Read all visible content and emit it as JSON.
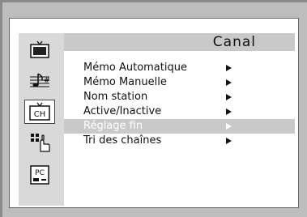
{
  "header": {
    "title": "Canal"
  },
  "sidebar": {
    "items": [
      {
        "icon": "tv-picture-icon"
      },
      {
        "icon": "sound-note-icon"
      },
      {
        "icon": "channel-icon",
        "label": "CH"
      },
      {
        "icon": "setup-hand-icon"
      },
      {
        "icon": "pc-icon",
        "label": "PC"
      }
    ],
    "selected_index": 2
  },
  "menu": {
    "items": [
      {
        "label": "Mémo Automatique"
      },
      {
        "label": "Mémo Manuelle"
      },
      {
        "label": "Nom station"
      },
      {
        "label": "Active/Inactive"
      },
      {
        "label": "Réglage fin"
      },
      {
        "label": "Tri des chaînes"
      }
    ],
    "selected_index": 4
  },
  "colors": {
    "selection_bar": "#c9c9c9",
    "sidebar_bg": "#d9d9d9",
    "background": "#bdbdbd",
    "osd_bg": "#ffffff"
  }
}
